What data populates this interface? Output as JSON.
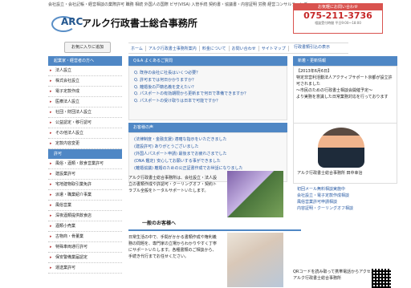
{
  "seo_text": "会社設立・会社記帳・経営相談の業際許可 職務 相続 外国人の国際 ビザ(VISA) 入管手続 契約書・協議書・内容証明 労務 経営コンサルティング",
  "logo": {
    "mark": "ARC",
    "name": "アルク行政書士総合事務所"
  },
  "phone": {
    "top": "お気軽にお問い合わせ",
    "number": "075-211-3736",
    "note": "相談受付時間 平日9:00〜18:00"
  },
  "favorite": "お気に入りに追加",
  "nav": [
    "ホーム",
    "アルク行政書士事務所案内",
    "料金について",
    "お問い合わせ",
    "サイトマップ"
  ],
  "nav_right": "行政書類引込の表示",
  "left": {
    "title": "起業家・経営者の方へ",
    "items": [
      "法人設立",
      "株式会社設立",
      "電子定款作成",
      "医療法人設立",
      "社団・財団法人設立",
      "公益認定・移行認可",
      "その他法人設立",
      "定款内容変更",
      "許可",
      "風俗・酒類・飲食営業許可",
      "建設業許可",
      "宅地建物取引業免許",
      "派遣・職業紹介事業",
      "風俗営業",
      "深夜酒類提供飲食店",
      "酒類小売業",
      "古物商・骨董業",
      "特殊車両通行許可",
      "保安警備業届認定",
      "運送業許可"
    ]
  },
  "main": {
    "title": "Q＆A よくあるご質問",
    "qa": [
      "Q. 既存の会社に社長はいくつ必要？",
      "Q. 許可までは何日かかりますか？",
      "Q. 離婚後の戸籍名義を変えたい？",
      "Q. パスポートの有効期限から更新まで何日で準備できますか？",
      "Q. パスポートの受け取りは日本で可能ですか？"
    ],
    "voice_title": "お客様の声",
    "voice": [
      "(法律制度・金融支援) 適確な指示をいただきました",
      "(建設許可) ありがとうございました",
      "(外国人パスポート申請) 最後までお疲れさまでした",
      "(DNA 鑑定) 安心してお願いする事ができました",
      "(離婚協議) 離婚のための公正証書作成でお世話になりました"
    ],
    "intro": "アルク行政書士総合事務所は、会社設立・法人設立の書類作成や許認可・クーリングオフ・契約トラブル全般をトータルサポートいたします。",
    "welcome": "一般のお客様へ",
    "body": "日常生活の中で、手間がかかる書類作成や権利義務の問題を、専門家の立場からわかりやすく丁寧にサポートいたします。各種書類のご相談から、手続き代行までお任せください。"
  },
  "right": {
    "news_title": "新着・更新情報",
    "news": [
      "【2013年6月6日】",
      "特定非営利活動法人アクティブサポート京都が設立許可されました",
      "〜市民のための行政書士相談会開催予定〜",
      "より実務を意識した日常業務対応を行っております"
    ],
    "profile_name": "アルク行政書士総合事務所\n田中幸治",
    "links": [
      "初回メール無料相談実施中",
      "会社設立・電子定款作成相談",
      "風俗営業許可申請相談",
      "内容証明・クーリングオフ相談"
    ],
    "contact": "QRコードを読み取って携帯電話からアクセスできます",
    "contact_name": "アルク行政書士総合事務所"
  }
}
